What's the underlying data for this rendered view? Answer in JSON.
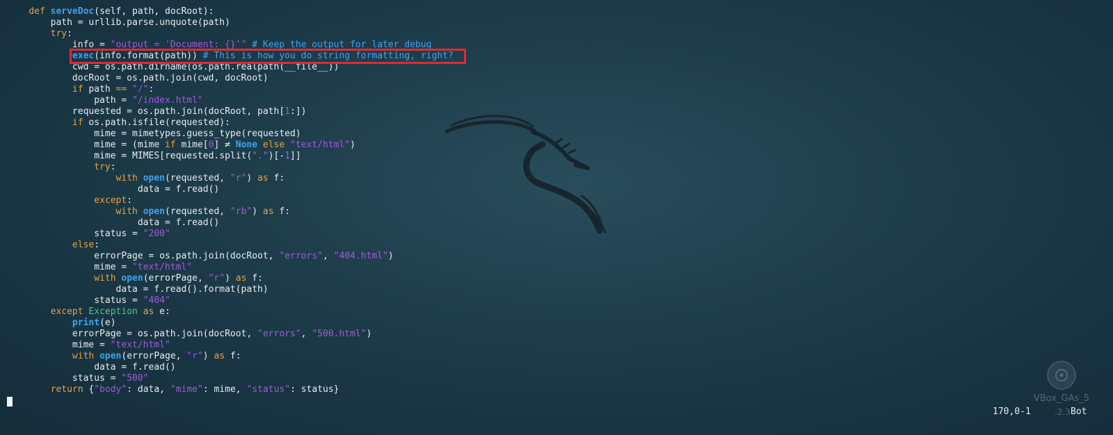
{
  "colors": {
    "background": "#1f3e4c",
    "keyword": "#e8a33d",
    "function_name": "#3ea4f0",
    "string": "#a259d9",
    "comment": "#3ea4f0",
    "class_name": "#4ec98a",
    "text": "#e9ecef",
    "highlight_border": "#e02a33"
  },
  "wallpaper": {
    "logo_icon": "kali-dragon-icon",
    "watermark_icon": "vbox-guest-additions-disc-icon",
    "watermark_text": "VBox_GAs_5",
    "watermark_version": ".2.3"
  },
  "editor": {
    "highlighted_line_index": 4,
    "lines": [
      [
        {
          "t": "    "
        },
        {
          "t": "def",
          "c": "kw"
        },
        {
          "t": " "
        },
        {
          "t": "serveDoc",
          "c": "fn"
        },
        {
          "t": "(self, path, docRoot):"
        }
      ],
      [
        {
          "t": "        path = urllib.parse.unquote(path)"
        }
      ],
      [
        {
          "t": "        "
        },
        {
          "t": "try",
          "c": "kw"
        },
        {
          "t": ":"
        }
      ],
      [
        {
          "t": "            info = "
        },
        {
          "t": "\"output = 'Document: {}'\"",
          "c": "str"
        },
        {
          "t": " "
        },
        {
          "t": "# Keep the output for later debug",
          "c": "com"
        }
      ],
      [
        {
          "t": "            "
        },
        {
          "t": "exec",
          "c": "bi"
        },
        {
          "t": "(info.format(path)) "
        },
        {
          "t": "# This is how you do string formatting, right?",
          "c": "com"
        }
      ],
      [
        {
          "t": "            cwd = os.path.dirname(os.path.realpath(__file__))"
        }
      ],
      [
        {
          "t": "            docRoot = os.path.join(cwd, docRoot)"
        }
      ],
      [
        {
          "t": "            "
        },
        {
          "t": "if",
          "c": "kw"
        },
        {
          "t": " path "
        },
        {
          "t": "==",
          "c": "kw"
        },
        {
          "t": " "
        },
        {
          "t": "\"/\"",
          "c": "str"
        },
        {
          "t": ":"
        }
      ],
      [
        {
          "t": "                path = "
        },
        {
          "t": "\"/index.html\"",
          "c": "str"
        }
      ],
      [
        {
          "t": "            requested = os.path.join(docRoot, path["
        },
        {
          "t": "1",
          "c": "num"
        },
        {
          "t": ":])"
        }
      ],
      [
        {
          "t": "            "
        },
        {
          "t": "if",
          "c": "kw"
        },
        {
          "t": " os.path.isfile(requested):"
        }
      ],
      [
        {
          "t": "                mime = mimetypes.guess_type(requested)"
        }
      ],
      [
        {
          "t": "                mime = (mime "
        },
        {
          "t": "if",
          "c": "kw"
        },
        {
          "t": " mime["
        },
        {
          "t": "0",
          "c": "num"
        },
        {
          "t": "] ≠ "
        },
        {
          "t": "None",
          "c": "bi"
        },
        {
          "t": " "
        },
        {
          "t": "else",
          "c": "kw"
        },
        {
          "t": " "
        },
        {
          "t": "\"text/html\"",
          "c": "str"
        },
        {
          "t": ")"
        }
      ],
      [
        {
          "t": "                mime = MIMES[requested.split("
        },
        {
          "t": "\".\"",
          "c": "str"
        },
        {
          "t": ")[-"
        },
        {
          "t": "1",
          "c": "num"
        },
        {
          "t": "]]"
        }
      ],
      [
        {
          "t": "                "
        },
        {
          "t": "try",
          "c": "kw"
        },
        {
          "t": ":"
        }
      ],
      [
        {
          "t": "                    "
        },
        {
          "t": "with",
          "c": "kw"
        },
        {
          "t": " "
        },
        {
          "t": "open",
          "c": "bi"
        },
        {
          "t": "(requested, "
        },
        {
          "t": "\"r\"",
          "c": "str"
        },
        {
          "t": ") "
        },
        {
          "t": "as",
          "c": "kw"
        },
        {
          "t": " f:"
        }
      ],
      [
        {
          "t": "                        data = f.read()"
        }
      ],
      [
        {
          "t": "                "
        },
        {
          "t": "except",
          "c": "kw"
        },
        {
          "t": ":"
        }
      ],
      [
        {
          "t": "                    "
        },
        {
          "t": "with",
          "c": "kw"
        },
        {
          "t": " "
        },
        {
          "t": "open",
          "c": "bi"
        },
        {
          "t": "(requested, "
        },
        {
          "t": "\"rb\"",
          "c": "str"
        },
        {
          "t": ") "
        },
        {
          "t": "as",
          "c": "kw"
        },
        {
          "t": " f:"
        }
      ],
      [
        {
          "t": "                        data = f.read()"
        }
      ],
      [
        {
          "t": "                status = "
        },
        {
          "t": "\"200\"",
          "c": "str"
        }
      ],
      [
        {
          "t": "            "
        },
        {
          "t": "else",
          "c": "kw"
        },
        {
          "t": ":"
        }
      ],
      [
        {
          "t": "                errorPage = os.path.join(docRoot, "
        },
        {
          "t": "\"errors\"",
          "c": "str"
        },
        {
          "t": ", "
        },
        {
          "t": "\"404.html\"",
          "c": "str"
        },
        {
          "t": ")"
        }
      ],
      [
        {
          "t": "                mime = "
        },
        {
          "t": "\"text/html\"",
          "c": "str"
        }
      ],
      [
        {
          "t": "                "
        },
        {
          "t": "with",
          "c": "kw"
        },
        {
          "t": " "
        },
        {
          "t": "open",
          "c": "bi"
        },
        {
          "t": "(errorPage, "
        },
        {
          "t": "\"r\"",
          "c": "str"
        },
        {
          "t": ") "
        },
        {
          "t": "as",
          "c": "kw"
        },
        {
          "t": " f:"
        }
      ],
      [
        {
          "t": "                    data = f.read().format(path)"
        }
      ],
      [
        {
          "t": "                status = "
        },
        {
          "t": "\"404\"",
          "c": "str"
        }
      ],
      [
        {
          "t": "        "
        },
        {
          "t": "except",
          "c": "kw"
        },
        {
          "t": " "
        },
        {
          "t": "Exception",
          "c": "cls"
        },
        {
          "t": " "
        },
        {
          "t": "as",
          "c": "kw"
        },
        {
          "t": " e:"
        }
      ],
      [
        {
          "t": "            "
        },
        {
          "t": "print",
          "c": "bi"
        },
        {
          "t": "(e)"
        }
      ],
      [
        {
          "t": "            errorPage = os.path.join(docRoot, "
        },
        {
          "t": "\"errors\"",
          "c": "str"
        },
        {
          "t": ", "
        },
        {
          "t": "\"500.html\"",
          "c": "str"
        },
        {
          "t": ")"
        }
      ],
      [
        {
          "t": "            mime = "
        },
        {
          "t": "\"text/html\"",
          "c": "str"
        }
      ],
      [
        {
          "t": "            "
        },
        {
          "t": "with",
          "c": "kw"
        },
        {
          "t": " "
        },
        {
          "t": "open",
          "c": "bi"
        },
        {
          "t": "(errorPage, "
        },
        {
          "t": "\"r\"",
          "c": "str"
        },
        {
          "t": ") "
        },
        {
          "t": "as",
          "c": "kw"
        },
        {
          "t": " f:"
        }
      ],
      [
        {
          "t": "                data = f.read()"
        }
      ],
      [
        {
          "t": "            status = "
        },
        {
          "t": "\"500\"",
          "c": "str"
        }
      ],
      [
        {
          "t": "        "
        },
        {
          "t": "return",
          "c": "kw"
        },
        {
          "t": " {"
        },
        {
          "t": "\"body\"",
          "c": "str"
        },
        {
          "t": ": data, "
        },
        {
          "t": "\"mime\"",
          "c": "str"
        },
        {
          "t": ": mime, "
        },
        {
          "t": "\"status\"",
          "c": "str"
        },
        {
          "t": ": status}"
        }
      ]
    ]
  },
  "statusline": {
    "position": "170,0-1",
    "scroll": "Bot"
  }
}
